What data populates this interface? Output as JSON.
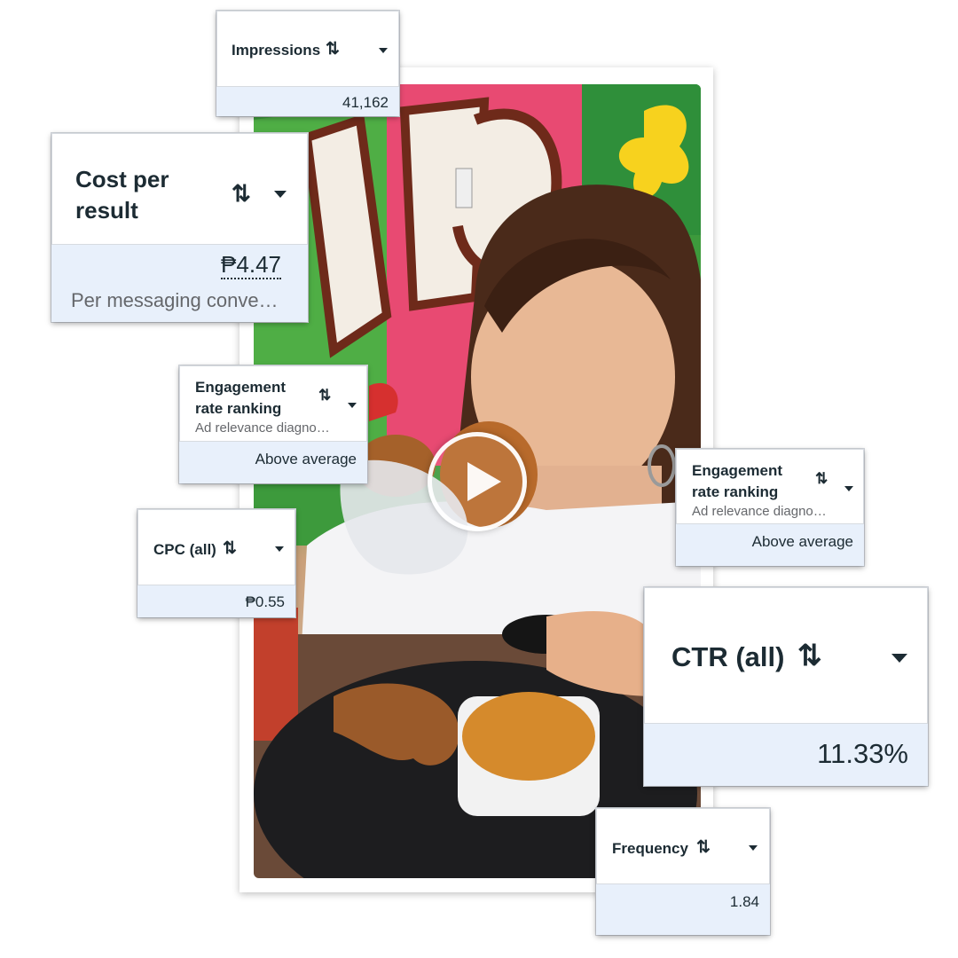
{
  "video": {
    "play_label": "Play"
  },
  "cards": {
    "impressions": {
      "title": "Impressions",
      "sort_icon": "⇅",
      "value": "41,162"
    },
    "cost_per_result": {
      "title_line1": "Cost per",
      "title_line2": "result",
      "sort_icon": "⇅",
      "value": "₱4.47",
      "subtitle": "Per messaging conve…"
    },
    "engagement_left": {
      "title_line1": "Engagement",
      "title_line2": "rate ranking",
      "subtitle": "Ad relevance diagno…",
      "sort_icon": "⇅",
      "value": "Above average"
    },
    "cpc": {
      "title": "CPC (all)",
      "sort_icon": "⇅",
      "value": "₱0.55"
    },
    "engagement_right": {
      "title_line1": "Engagement",
      "title_line2": "rate ranking",
      "subtitle": "Ad relevance diagno…",
      "sort_icon": "⇅",
      "value": "Above average"
    },
    "ctr": {
      "title": "CTR (all)",
      "sort_icon": "⇅",
      "value": "11.33%"
    },
    "frequency": {
      "title": "Frequency",
      "sort_icon": "⇅",
      "value": "1.84"
    }
  },
  "colors": {
    "text": "#1c2b33",
    "value_bg": "#e8f0fb",
    "subtext": "#65676b"
  }
}
